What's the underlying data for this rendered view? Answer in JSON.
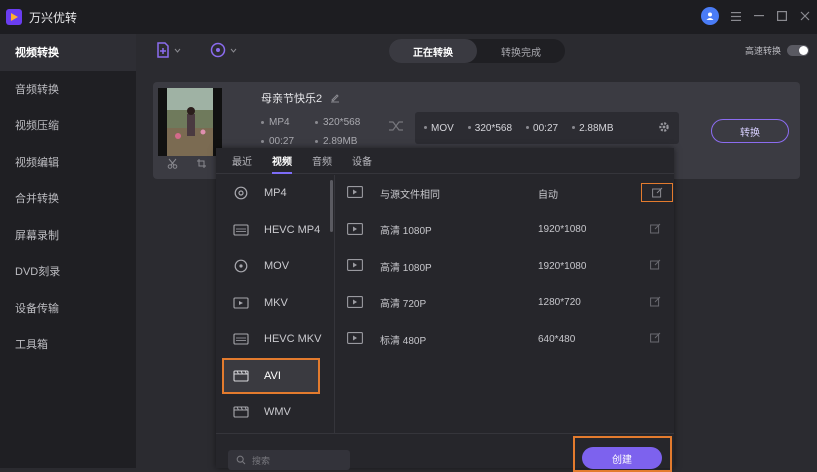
{
  "app": {
    "title": "万兴优转"
  },
  "sidebar": {
    "items": [
      {
        "label": "视频转换"
      },
      {
        "label": "音频转换"
      },
      {
        "label": "视频压缩"
      },
      {
        "label": "视频编辑"
      },
      {
        "label": "合并转换"
      },
      {
        "label": "屏幕录制"
      },
      {
        "label": "DVD刻录"
      },
      {
        "label": "设备传输"
      },
      {
        "label": "工具箱"
      }
    ]
  },
  "toolbar": {
    "tabs": [
      {
        "label": "正在转换"
      },
      {
        "label": "转换完成"
      }
    ],
    "speed_label": "高速转换"
  },
  "file": {
    "name": "母亲节快乐2",
    "source_format": "MP4",
    "source_resolution": "320*568",
    "source_duration": "00:27",
    "source_size": "2.89MB",
    "target_format": "MOV",
    "target_resolution": "320*568",
    "target_duration": "00:27",
    "target_size": "2.88MB",
    "convert_label": "转换"
  },
  "panel": {
    "tabs": [
      {
        "label": "最近"
      },
      {
        "label": "视频"
      },
      {
        "label": "音频"
      },
      {
        "label": "设备"
      }
    ],
    "formats": [
      {
        "label": "MP4"
      },
      {
        "label": "HEVC MP4"
      },
      {
        "label": "MOV"
      },
      {
        "label": "MKV"
      },
      {
        "label": "HEVC MKV"
      },
      {
        "label": "AVI"
      },
      {
        "label": "WMV"
      }
    ],
    "resolutions": [
      {
        "name": "与源文件相同",
        "size": "自动"
      },
      {
        "name": "高清 1080P",
        "size": "1920*1080"
      },
      {
        "name": "高清 1080P",
        "size": "1920*1080"
      },
      {
        "name": "高清 720P",
        "size": "1280*720"
      },
      {
        "name": "标清 480P",
        "size": "640*480"
      }
    ],
    "search_placeholder": "搜索",
    "create_label": "创建"
  },
  "colors": {
    "accent": "#7d62ee",
    "highlight": "#e37b2e"
  }
}
